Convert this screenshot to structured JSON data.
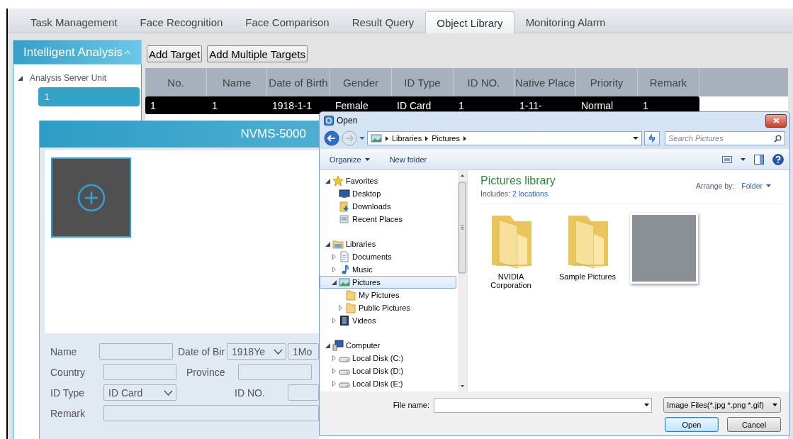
{
  "tabs": [
    {
      "label": "Task Management",
      "selected": false
    },
    {
      "label": "Face Recognition",
      "selected": false
    },
    {
      "label": "Face Comparison",
      "selected": false
    },
    {
      "label": "Result Query",
      "selected": false
    },
    {
      "label": "Object Library",
      "selected": true
    },
    {
      "label": "Monitoring Alarm",
      "selected": false
    }
  ],
  "sidebar": {
    "title": "Intelligent Analysis",
    "expanded": true,
    "tree": [
      {
        "label": "Analysis Server Unit",
        "expanded": true,
        "children": [
          {
            "label": "1",
            "selected": true
          }
        ]
      }
    ]
  },
  "toolbar": {
    "buttons": [
      "Add Target",
      "Add Multiple Targets"
    ]
  },
  "table": {
    "columns": [
      "No.",
      "Name",
      "Date of Birth",
      "Gender",
      "ID Type",
      "ID NO.",
      "Native Place",
      "Priority",
      "Remark"
    ],
    "rows": [
      {
        "selected": true,
        "cells": [
          "1",
          "1",
          "1918-1-1",
          "Female",
          "ID Card",
          "1",
          "1-11-",
          "Normal",
          "1"
        ]
      }
    ]
  },
  "add_dialog": {
    "title": "NVMS-5000",
    "form": [
      [
        {
          "kind": "label",
          "text": "Name"
        },
        {
          "kind": "input"
        },
        {
          "kind": "label",
          "text": "Date of Bir"
        },
        {
          "kind": "select",
          "value": "1918Ye"
        },
        {
          "kind": "select",
          "value": "1Mo"
        }
      ],
      [
        {
          "kind": "label",
          "text": "Country"
        },
        {
          "kind": "input"
        },
        {
          "kind": "label",
          "text": "Province"
        },
        {
          "kind": "input"
        }
      ],
      [
        {
          "kind": "label",
          "text": "ID Type"
        },
        {
          "kind": "select",
          "value": "ID Card"
        },
        {
          "kind": "label",
          "text": "ID NO."
        },
        {
          "kind": "input"
        }
      ],
      [
        {
          "kind": "label",
          "text": "Remark"
        },
        {
          "kind": "input"
        }
      ]
    ]
  },
  "open_dialog": {
    "title": "Open",
    "breadcrumb": [
      "Libraries",
      "Pictures"
    ],
    "search": {
      "placeholder": "Search Pictures"
    },
    "toolbar": {
      "organize": "Organize",
      "new_folder": "New folder"
    },
    "nav": [
      {
        "label": "Favorites",
        "kind": "star",
        "expanded": true,
        "selected": false,
        "children": [
          {
            "label": "Desktop",
            "kind": "desktop",
            "selected": false
          },
          {
            "label": "Downloads",
            "kind": "download",
            "selected": false
          },
          {
            "label": "Recent Places",
            "kind": "recent",
            "selected": false
          }
        ]
      },
      {
        "label": "Libraries",
        "kind": "library",
        "expanded": true,
        "selected": false,
        "children": [
          {
            "label": "Documents",
            "kind": "document",
            "expanded": false,
            "selected": false
          },
          {
            "label": "Music",
            "kind": "music",
            "expanded": false,
            "selected": false
          },
          {
            "label": "Pictures",
            "kind": "pictures",
            "expanded": true,
            "selected": true,
            "children": [
              {
                "label": "My Pictures",
                "kind": "folder",
                "selected": false
              },
              {
                "label": "Public Pictures",
                "kind": "folder",
                "expanded": false,
                "selected": false
              }
            ]
          },
          {
            "label": "Videos",
            "kind": "video",
            "expanded": false,
            "selected": false
          }
        ]
      },
      {
        "label": "Computer",
        "kind": "computer",
        "expanded": true,
        "selected": false,
        "children": [
          {
            "label": "Local Disk (C:)",
            "kind": "disk",
            "expanded": false,
            "selected": false
          },
          {
            "label": "Local Disk (D:)",
            "kind": "disk",
            "expanded": false,
            "selected": false
          },
          {
            "label": "Local Disk (E:)",
            "kind": "disk",
            "expanded": false,
            "selected": false
          }
        ]
      }
    ],
    "library": {
      "title": "Pictures library",
      "includes_label": "Includes:",
      "includes_link": "2 locations",
      "arrange_label": "Arrange by:",
      "arrange_value": "Folder"
    },
    "files": [
      {
        "kind": "folder",
        "label": "NVIDIA Corporation"
      },
      {
        "kind": "folder",
        "label": "Sample Pictures"
      },
      {
        "kind": "image"
      }
    ],
    "file_name_label": "File name:",
    "file_type": "Image Files(*.jpg *.png *.gif)",
    "buttons": [
      {
        "label": "Open",
        "default": true
      },
      {
        "label": "Cancel",
        "default": false
      }
    ]
  }
}
